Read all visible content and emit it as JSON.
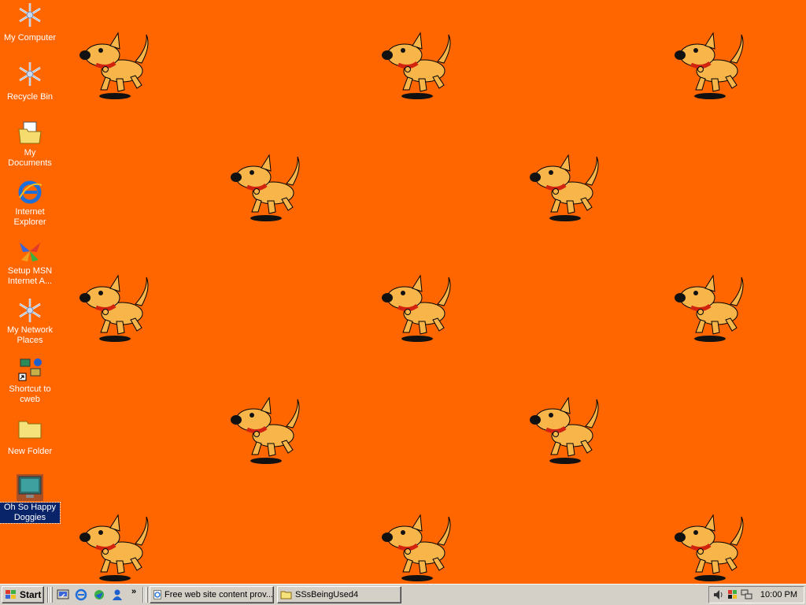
{
  "desktop": {
    "background_color": "#FF6600",
    "wallpaper_tile": "cartoon-dog",
    "icons": [
      {
        "label": "My Computer",
        "icon": "my-computer-icon"
      },
      {
        "label": "Recycle Bin",
        "icon": "recycle-bin-icon"
      },
      {
        "label": "My Documents",
        "icon": "my-documents-icon"
      },
      {
        "label": "Internet Explorer",
        "icon": "internet-explorer-icon"
      },
      {
        "label": "Setup MSN Internet A...",
        "icon": "msn-butterfly-icon"
      },
      {
        "label": "My Network Places",
        "icon": "network-places-icon"
      },
      {
        "label": "Shortcut to cweb",
        "icon": "network-shortcut-icon"
      },
      {
        "label": "New Folder",
        "icon": "folder-icon"
      },
      {
        "label": "Oh So Happy Doggies",
        "icon": "monitor-screen-icon",
        "selected": true
      }
    ]
  },
  "taskbar": {
    "start_label": "Start",
    "quick_launch": [
      "show-desktop-icon",
      "ie-icon",
      "outlook-express-icon",
      "msn-messenger-icon"
    ],
    "chevron": "»",
    "tasks": [
      {
        "label": "Free web site content prov...",
        "icon": "ie-page-icon"
      },
      {
        "label": "SSsBeingUsed4",
        "icon": "open-folder-icon"
      }
    ],
    "tray_icons": [
      "volume-icon",
      "windows-flag-icon",
      "network-icon"
    ],
    "clock": "10:00 PM"
  }
}
